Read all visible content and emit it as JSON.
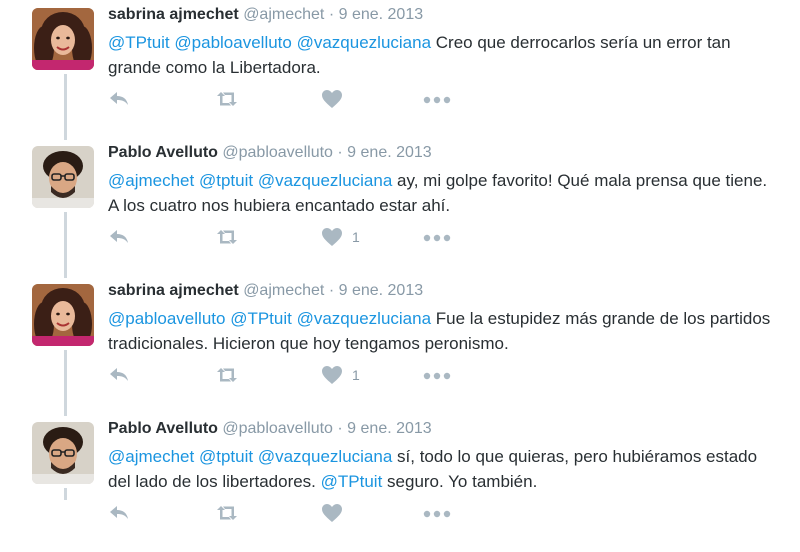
{
  "tweets": [
    {
      "name": "sabrina ajmechet",
      "handle": "@ajmechet",
      "separator": "·",
      "date": "9 ene. 2013",
      "segments": [
        {
          "text": "@TPtuit",
          "mention": true
        },
        {
          "text": " ",
          "mention": false
        },
        {
          "text": "@pabloavelluto",
          "mention": true
        },
        {
          "text": " ",
          "mention": false
        },
        {
          "text": "@vazquezluciana",
          "mention": true
        },
        {
          "text": " Creo que derrocarlos sería un error tan grande como la Libertadora.",
          "mention": false
        }
      ],
      "avatar": "sabrina",
      "like_count": ""
    },
    {
      "name": "Pablo Avelluto",
      "handle": "@pabloavelluto",
      "separator": "·",
      "date": "9 ene. 2013",
      "segments": [
        {
          "text": "@ajmechet",
          "mention": true
        },
        {
          "text": " ",
          "mention": false
        },
        {
          "text": "@tptuit",
          "mention": true
        },
        {
          "text": " ",
          "mention": false
        },
        {
          "text": "@vazquezluciana",
          "mention": true
        },
        {
          "text": " ay, mi golpe favorito! Qué mala prensa que tiene. A los cuatro nos hubiera encantado estar ahí.",
          "mention": false
        }
      ],
      "avatar": "pablo",
      "like_count": "1"
    },
    {
      "name": "sabrina ajmechet",
      "handle": "@ajmechet",
      "separator": "·",
      "date": "9 ene. 2013",
      "segments": [
        {
          "text": "@pabloavelluto",
          "mention": true
        },
        {
          "text": " ",
          "mention": false
        },
        {
          "text": "@TPtuit",
          "mention": true
        },
        {
          "text": " ",
          "mention": false
        },
        {
          "text": "@vazquezluciana",
          "mention": true
        },
        {
          "text": " Fue la estupidez más grande de los partidos tradicionales. Hicieron que hoy tengamos peronismo.",
          "mention": false
        }
      ],
      "avatar": "sabrina",
      "like_count": "1"
    },
    {
      "name": "Pablo Avelluto",
      "handle": "@pabloavelluto",
      "separator": "·",
      "date": "9 ene. 2013",
      "segments": [
        {
          "text": "@ajmechet",
          "mention": true
        },
        {
          "text": " ",
          "mention": false
        },
        {
          "text": "@tptuit",
          "mention": true
        },
        {
          "text": " ",
          "mention": false
        },
        {
          "text": "@vazquezluciana",
          "mention": true
        },
        {
          "text": " sí, todo lo que quieras, pero hubiéramos estado del lado de los libertadores. ",
          "mention": false
        },
        {
          "text": "@TPtuit",
          "mention": true
        },
        {
          "text": " seguro. Yo también.",
          "mention": false
        }
      ],
      "avatar": "pablo",
      "like_count": ""
    }
  ],
  "icons": {
    "reply": "reply-icon",
    "retweet": "retweet-icon",
    "like": "heart-icon",
    "more": "more-icon"
  },
  "colors": {
    "icon": "#aab8c2",
    "mention": "#1b95e0",
    "meta": "#8899a6",
    "thread_line": "#cfd7dd"
  }
}
